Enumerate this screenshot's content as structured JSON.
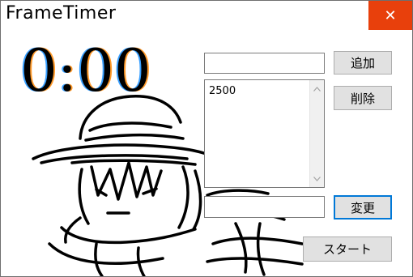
{
  "window": {
    "title": "FrameTimer",
    "close_glyph": "✕"
  },
  "timer": {
    "display": "0:00"
  },
  "add": {
    "input_value": "",
    "button_label": "追加"
  },
  "remove": {
    "button_label": "削除"
  },
  "frames_list": {
    "items": [
      "2500"
    ]
  },
  "change": {
    "input_value": "",
    "button_label": "変更"
  },
  "start": {
    "button_label": "スタート"
  },
  "icons": {
    "scroll_up": "chevron-up-icon",
    "scroll_down": "chevron-down-icon",
    "close": "close-icon"
  },
  "colors": {
    "close_bg": "#e8400c",
    "focus_border": "#0078d7",
    "button_bg": "#e1e1e1"
  }
}
